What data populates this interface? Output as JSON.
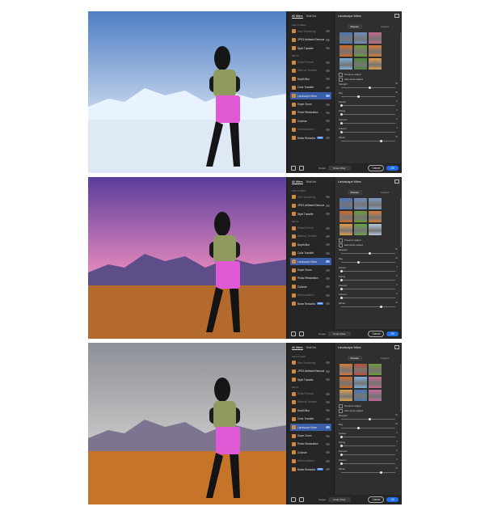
{
  "colors": {
    "accent": "#1f6ee8",
    "panel": "#2b2b2b",
    "selected": "#3a5ea8"
  },
  "neural_filters": {
    "tabs": [
      "All filters",
      "Wait list"
    ],
    "sections": {
      "featured": "FEATURED",
      "beta": "BETA"
    },
    "featured_items": [
      "Skin Smoothing",
      "JPEG Artifacts Removal",
      "Style Transfer"
    ],
    "beta_items": [
      "Smart Portrait",
      "Makeup Transfer",
      "Depth Blur",
      "Color Transfer",
      "Landscape Mixer",
      "Super Zoom",
      "Photo Restoration",
      "Colorize",
      "Harmonization",
      "Noise Reduction"
    ],
    "new_badge": "NEW",
    "selected_filter": "Landscape Mixer",
    "detail_title": "Landscape Mixer",
    "subtabs": [
      "Presets",
      "Custom"
    ],
    "checkboxes": [
      "Preserve subject",
      "Harmonize subject"
    ],
    "sliders": [
      {
        "label": "Strength",
        "value": 50
      },
      {
        "label": "Day",
        "value": 30
      },
      {
        "label": "Sunset",
        "value": 0
      },
      {
        "label": "Spring",
        "value": 0
      },
      {
        "label": "Summer",
        "value": 0
      },
      {
        "label": "Autumn",
        "value": 0
      },
      {
        "label": "Winter",
        "value": 70
      }
    ],
    "output_label": "Output",
    "output_value": "Smart Filter",
    "cancel": "Cancel",
    "ok": "OK"
  },
  "variants": [
    {
      "name": "winter",
      "sky_top": "#4f7fc4",
      "sky_bottom": "#c8d8ee",
      "mountain": "#e9f2ff",
      "ground": "#dfe8f5",
      "presets": [
        "#4a77b5",
        "#6f8fbf",
        "#c46a8f",
        "#cc6a2a",
        "#6f9a3a",
        "#d47b3a",
        "#7bb0d9",
        "#4d8a3c",
        "#e0a04a"
      ],
      "slider_active": 6
    },
    {
      "name": "sunset",
      "sky_top": "#5a3e9c",
      "sky_bottom": "#f08fc0",
      "mountain": "#5d4e8a",
      "ground": "#b46a2d",
      "presets": [
        "#4a77b5",
        "#6f8fbf",
        "#7aa0c8",
        "#cc6a2a",
        "#6f9a3a",
        "#d47b3a",
        "#e0a04a",
        "#6aa24a",
        "#b8c9d8"
      ],
      "slider_active": 2
    },
    {
      "name": "autumn",
      "sky_top": "#8d9097",
      "sky_bottom": "#c9c9c9",
      "mountain": "#7d7590",
      "ground": "#c7742b",
      "presets": [
        "#d47b3a",
        "#b8503a",
        "#6f9a3a",
        "#cc6a2a",
        "#7bb0d9",
        "#c46a8f",
        "#d9a04a",
        "#4a77b5",
        "#c26a9a"
      ],
      "slider_active": 5
    }
  ]
}
